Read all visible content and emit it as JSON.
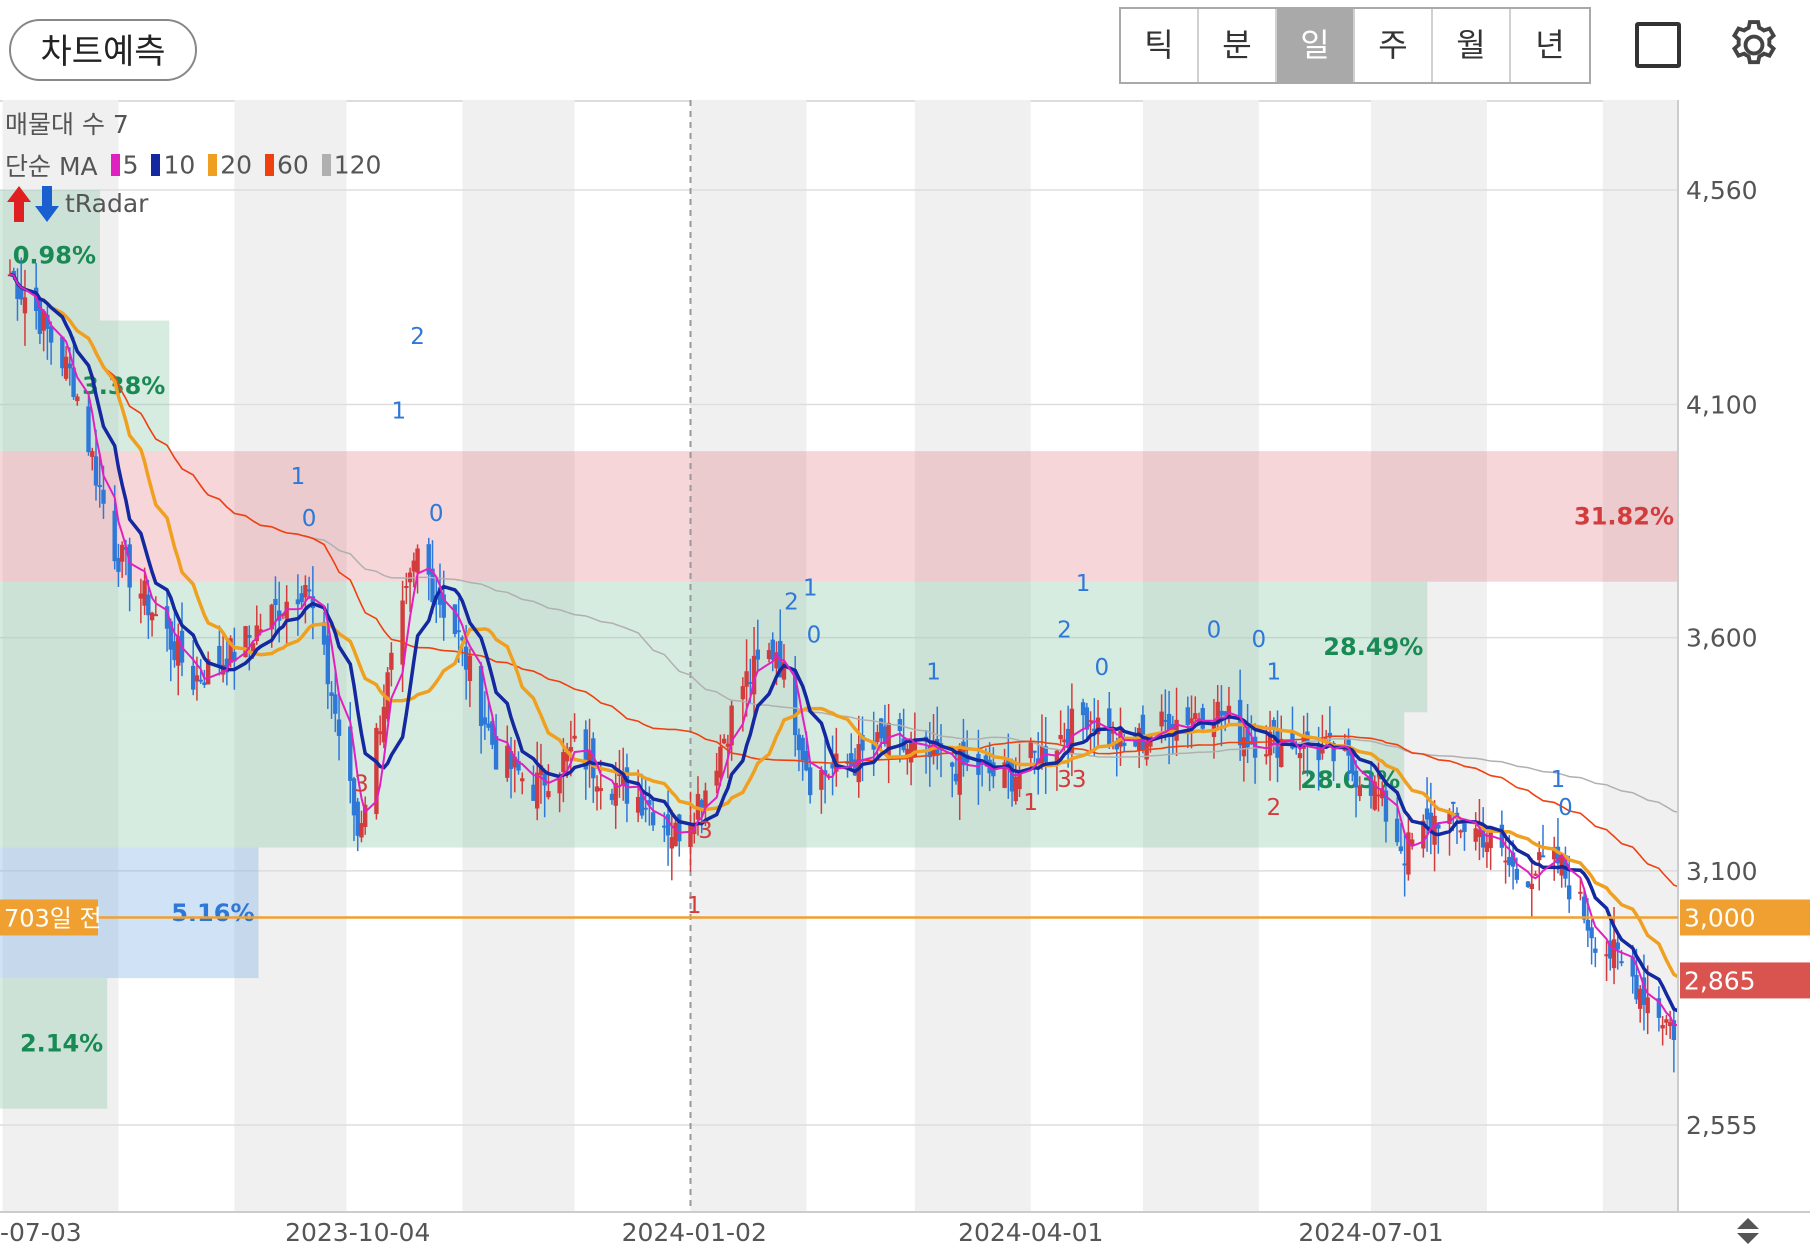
{
  "toolbar": {
    "predict_label": "차트예측",
    "period_tabs": [
      "틱",
      "분",
      "일",
      "주",
      "월",
      "년"
    ],
    "active_period": "일"
  },
  "legend": {
    "volume_profile": "매물대 수 7",
    "ma_prefix": "단순 MA",
    "ma_periods": [
      "5",
      "10",
      "20",
      "60",
      "120"
    ],
    "ma_colors": [
      "#e020c0",
      "#1428a0",
      "#f0a020",
      "#f04010",
      "#b0b0b0"
    ],
    "radar": "tRadar"
  },
  "colors": {
    "up": "#d23c3c",
    "down": "#2e78d8",
    "ma5": "#e020c0",
    "ma10": "#1428a0",
    "ma20": "#f0a020",
    "ma60": "#f04010",
    "ma120": "#b0b0b0",
    "current_price_tag": "#d9534f",
    "ref_line": "#f0a030"
  },
  "chart_data": {
    "type": "candlestick",
    "x_ticks": [
      "2023-07-03",
      "2023-10-04",
      "2024-01-02",
      "2024-04-01",
      "2024-07-01"
    ],
    "x_tick_shown": [
      "-07-03",
      "2023-10-04",
      "2024-01-02",
      "2024-04-01",
      "2024-07-01"
    ],
    "y_ticks": [
      4560,
      4100,
      3600,
      3100,
      2555
    ],
    "ylim": [
      2400,
      4760
    ],
    "current_price": 2865,
    "reference_line": {
      "value": 3000,
      "label": "703일 전"
    },
    "volume_profile_zones": [
      {
        "from": 3720,
        "to": 4000,
        "pct": "31.82%",
        "color": "red"
      },
      {
        "from": 3440,
        "to": 3720,
        "pct": "28.49%",
        "color": "green"
      },
      {
        "from": 3150,
        "to": 3440,
        "pct": "28.03%",
        "color": "green"
      },
      {
        "from": 4000,
        "to": 4280,
        "pct": "3.38%",
        "color": "green"
      },
      {
        "from": 4280,
        "to": 4560,
        "pct": "0.98%",
        "color": "green"
      },
      {
        "from": 2870,
        "to": 3150,
        "pct": "5.16%",
        "color": "blue"
      },
      {
        "from": 2590,
        "to": 2870,
        "pct": "2.14%",
        "color": "green"
      }
    ],
    "ohlc_path": [
      [
        "2023-07-03",
        4380
      ],
      [
        "2023-07-10",
        4300
      ],
      [
        "2023-07-20",
        4150
      ],
      [
        "2023-07-31",
        3790
      ],
      [
        "2023-08-10",
        3660
      ],
      [
        "2023-08-21",
        3510
      ],
      [
        "2023-09-01",
        3570
      ],
      [
        "2023-09-11",
        3650
      ],
      [
        "2023-09-20",
        3720
      ],
      [
        "2023-09-27",
        3480
      ],
      [
        "2023-10-04",
        3180
      ],
      [
        "2023-10-11",
        3470
      ],
      [
        "2023-10-20",
        3780
      ],
      [
        "2023-10-31",
        3600
      ],
      [
        "2023-11-10",
        3350
      ],
      [
        "2023-11-20",
        3280
      ],
      [
        "2023-12-01",
        3360
      ],
      [
        "2023-12-11",
        3290
      ],
      [
        "2023-12-20",
        3250
      ],
      [
        "2023-12-28",
        3180
      ],
      [
        "2024-01-05",
        3280
      ],
      [
        "2024-01-15",
        3500
      ],
      [
        "2024-01-24",
        3580
      ],
      [
        "2024-02-02",
        3300
      ],
      [
        "2024-02-13",
        3330
      ],
      [
        "2024-02-23",
        3380
      ],
      [
        "2024-03-05",
        3340
      ],
      [
        "2024-03-15",
        3320
      ],
      [
        "2024-03-26",
        3300
      ],
      [
        "2024-04-05",
        3360
      ],
      [
        "2024-04-16",
        3440
      ],
      [
        "2024-04-26",
        3360
      ],
      [
        "2024-05-08",
        3420
      ],
      [
        "2024-05-20",
        3450
      ],
      [
        "2024-05-30",
        3380
      ],
      [
        "2024-06-10",
        3380
      ],
      [
        "2024-06-20",
        3350
      ],
      [
        "2024-07-01",
        3290
      ],
      [
        "2024-07-10",
        3140
      ],
      [
        "2024-07-19",
        3220
      ],
      [
        "2024-07-31",
        3180
      ],
      [
        "2024-08-09",
        3090
      ],
      [
        "2024-08-20",
        3120
      ],
      [
        "2024-08-30",
        2960
      ],
      [
        "2024-09-09",
        2870
      ],
      [
        "2024-09-20",
        2760
      ],
      [
        "2024-09-27",
        2780
      ]
    ],
    "annotations": [
      "1",
      "0",
      "2",
      "3"
    ]
  }
}
